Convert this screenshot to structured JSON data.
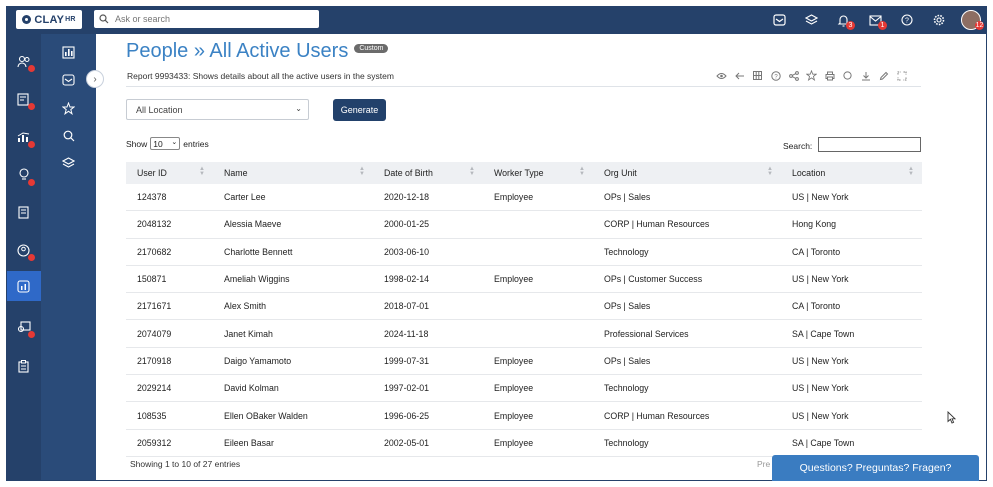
{
  "brand": {
    "logo_text": "CLAY",
    "logo_suffix": "HR"
  },
  "topbar": {
    "search_placeholder": "Ask or search",
    "icons": [
      {
        "name": "mail-icon",
        "badge": ""
      },
      {
        "name": "layers-icon",
        "badge": ""
      },
      {
        "name": "bell-icon",
        "badge": "3"
      },
      {
        "name": "envelope-icon",
        "badge": "1"
      },
      {
        "name": "help-icon",
        "badge": ""
      },
      {
        "name": "gear-icon",
        "badge": ""
      }
    ],
    "avatar_badge": "12"
  },
  "rail_icons": [
    "people-icon",
    "id-card-icon",
    "chart-icon",
    "lightbulb-icon",
    "document-icon",
    "user-circle-icon",
    "report-icon",
    "recruit-icon",
    "clipboard-icon"
  ],
  "subrail_icons": [
    "bar-chart-icon",
    "inbox-icon",
    "star-icon",
    "search-icon",
    "layers-icon"
  ],
  "page": {
    "title": "People » All Active Users",
    "chip": "Custom",
    "subtitle": "Report  9993433: Shows details about all the active users in the system"
  },
  "filters": {
    "location_value": "All Location",
    "generate_label": "Generate"
  },
  "table_controls": {
    "show_label": "Show",
    "entries_value": "10",
    "entries_label": "entries",
    "search_label": "Search:"
  },
  "table": {
    "columns": [
      "User ID",
      "Name",
      "Date of Birth",
      "Worker Type",
      "Org Unit",
      "Location"
    ],
    "rows": [
      [
        "124378",
        "Carter Lee",
        "2020-12-18",
        "Employee",
        "OPs | Sales",
        "US | New York"
      ],
      [
        "2048132",
        "Alessia Maeve",
        "2000-01-25",
        "",
        "CORP | Human Resources",
        "Hong Kong"
      ],
      [
        "2170682",
        "Charlotte Bennett",
        "2003-06-10",
        "",
        "Technology",
        "CA | Toronto"
      ],
      [
        "150871",
        "Ameliah Wiggins",
        "1998-02-14",
        "Employee",
        "OPs | Customer Success",
        "US | New York"
      ],
      [
        "2171671",
        "Alex Smith",
        "2018-07-01",
        "",
        "OPs | Sales",
        "CA | Toronto"
      ],
      [
        "2074079",
        "Janet Kimah",
        "2024-11-18",
        "",
        "Professional Services",
        "SA | Cape Town"
      ],
      [
        "2170918",
        "Daigo Yamamoto",
        "1999-07-31",
        "Employee",
        "OPs | Sales",
        "US | New York"
      ],
      [
        "2029214",
        "David Kolman",
        "1997-02-01",
        "Employee",
        "Technology",
        "US | New York"
      ],
      [
        "108535",
        "Ellen OBaker Walden",
        "1996-06-25",
        "Employee",
        "CORP | Human Resources",
        "US | New York"
      ],
      [
        "2059312",
        "Eileen Basar",
        "2002-05-01",
        "Employee",
        "Technology",
        "SA | Cape Town"
      ]
    ]
  },
  "footer": {
    "info": "Showing 1 to 10 of 27 entries",
    "prev_label": "Pre",
    "help_label": "Questions? Preguntas? Fragen?"
  }
}
